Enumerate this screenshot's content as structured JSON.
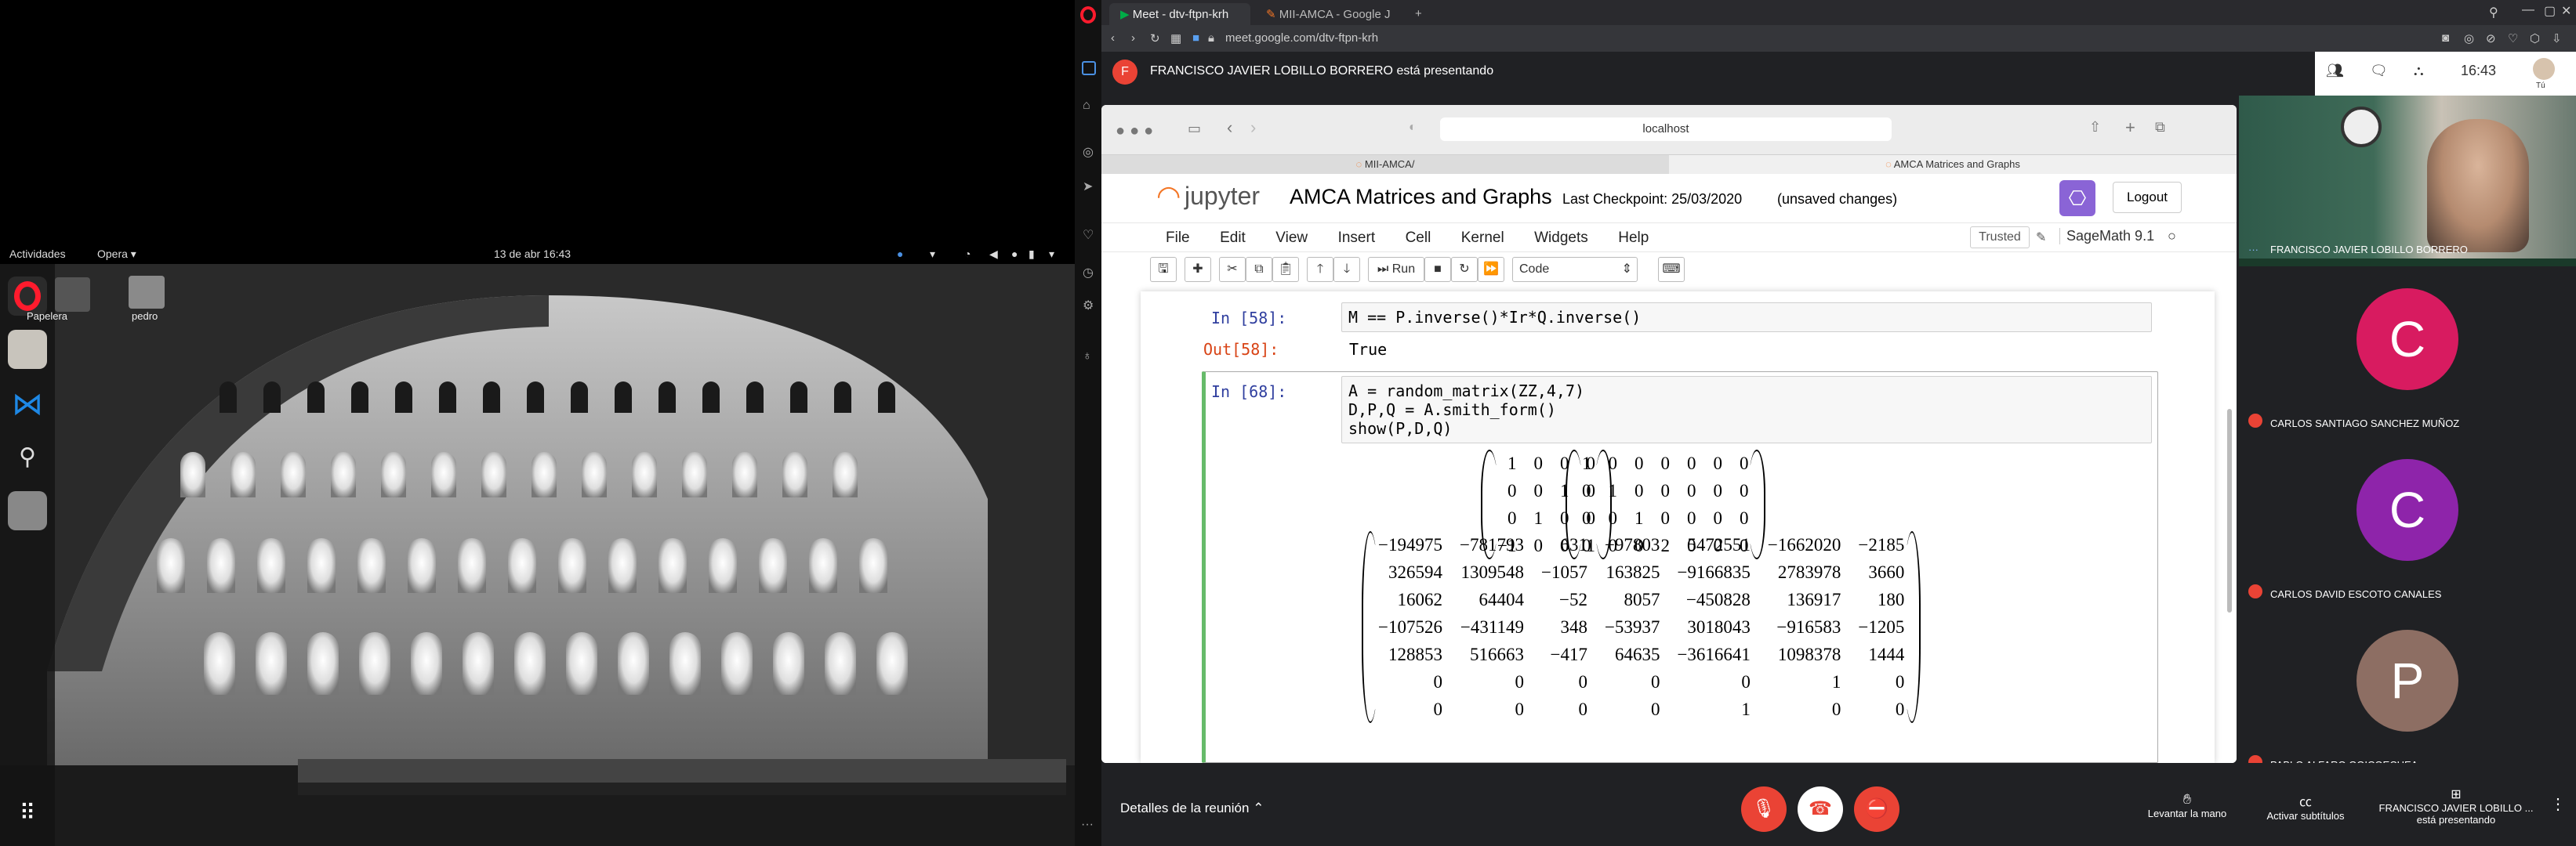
{
  "gnome": {
    "activities": "Actividades",
    "app": "Opera",
    "date": "13 de abr  16:43"
  },
  "desktop": {
    "icons": [
      {
        "label": "Papelera"
      },
      {
        "label": "pedro"
      }
    ]
  },
  "opera": {
    "tabs": [
      {
        "label": "Meet - dtv-ftpn-krh",
        "active": true
      },
      {
        "label": "MII-AMCA - Google J"
      }
    ],
    "url": "meet.google.com/dtv-ftpn-krh",
    "colors": {
      "accent": "#ff1b2d",
      "sidebar": "#121212",
      "tabbar": "#2a2a2e"
    }
  },
  "meet": {
    "presenter_initial": "F",
    "presenter_banner": "FRANCISCO JAVIER LOBILLO BORRERO está presentando",
    "time": "16:43",
    "you_label": "Tú",
    "details": "Detalles de la reunión",
    "raise_hand": "Levantar la mano",
    "captions": "Activar subtítulos",
    "present_name": "FRANCISCO JAVIER LOBILLO ...",
    "present_state": "está presentando",
    "participants": [
      {
        "name": "FRANCISCO JAVIER LOBILLO BORRERO",
        "type": "video"
      },
      {
        "name": "CARLOS SANTIAGO SANCHEZ MUÑOZ",
        "initial": "C",
        "color": "#d81b60"
      },
      {
        "name": "CARLOS DAVID ESCOTO CANALES",
        "initial": "C",
        "color": "#8e24aa"
      },
      {
        "name": "PABLO ALFARO GOICOECHEA",
        "initial": "P",
        "color": "#8d6e63"
      }
    ],
    "colors": {
      "mic_off": "#ea4335",
      "bg": "#202124"
    }
  },
  "safari": {
    "url": "localhost",
    "tabs": [
      "MII-AMCA/",
      "AMCA Matrices and Graphs"
    ]
  },
  "jupyter": {
    "logo": "jupyter",
    "title": "AMCA Matrices and Graphs",
    "checkpoint": "Last Checkpoint: 25/03/2020",
    "unsaved": "(unsaved changes)",
    "logout": "Logout",
    "menu": [
      "File",
      "Edit",
      "View",
      "Insert",
      "Cell",
      "Kernel",
      "Widgets",
      "Help"
    ],
    "trusted": "Trusted",
    "kernel": "SageMath 9.1",
    "run": "Run",
    "celltype": "Code",
    "cells": [
      {
        "in": "In [58]:",
        "code": "M == P.inverse()*Ir*Q.inverse()",
        "out_prompt": "Out[58]:",
        "out": "True"
      },
      {
        "in": "In [68]:",
        "code": [
          "A = random_matrix(ZZ,4,7)",
          "D,P,Q = A.smith_form()",
          "show(P,D,Q)"
        ]
      }
    ],
    "P": [
      [
        "1",
        "0",
        "0",
        "0"
      ],
      [
        "0",
        "0",
        "1",
        "0"
      ],
      [
        "0",
        "1",
        "0",
        "0"
      ],
      [
        "−1",
        "0",
        "0",
        "1"
      ]
    ],
    "D": [
      [
        "1",
        "0",
        "0",
        "0",
        "0",
        "0",
        "0"
      ],
      [
        "0",
        "1",
        "0",
        "0",
        "0",
        "0",
        "0"
      ],
      [
        "0",
        "0",
        "1",
        "0",
        "0",
        "0",
        "0"
      ],
      [
        "0",
        "0",
        "0",
        "2",
        "0",
        "0",
        "0"
      ]
    ],
    "Q": [
      [
        "−194975",
        "−781793",
        "631",
        "−97803",
        "5472551",
        "−1662020",
        "−2185"
      ],
      [
        "326594",
        "1309548",
        "−1057",
        "163825",
        "−9166835",
        "2783978",
        "3660"
      ],
      [
        "16062",
        "64404",
        "−52",
        "8057",
        "−450828",
        "136917",
        "180"
      ],
      [
        "−107526",
        "−431149",
        "348",
        "−53937",
        "3018043",
        "−916583",
        "−1205"
      ],
      [
        "128853",
        "516663",
        "−417",
        "64635",
        "−3616641",
        "1098378",
        "1444"
      ],
      [
        "0",
        "0",
        "0",
        "0",
        "0",
        "1",
        "0"
      ],
      [
        "0",
        "0",
        "0",
        "0",
        "1",
        "0",
        "0"
      ]
    ]
  }
}
